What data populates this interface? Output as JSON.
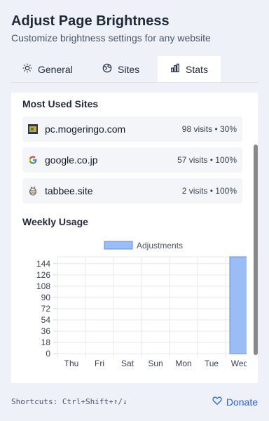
{
  "header": {
    "title": "Adjust Page Brightness",
    "subtitle": "Customize brightness settings for any website"
  },
  "tabs": [
    {
      "label": "General",
      "icon": "sun-icon"
    },
    {
      "label": "Sites",
      "icon": "globe-icon"
    },
    {
      "label": "Stats",
      "icon": "bar-chart-icon",
      "active": true
    }
  ],
  "most_used": {
    "title": "Most Used Sites",
    "sites": [
      {
        "name": "pc.mogeringo.com",
        "stats": "98 visits • 30%",
        "icon": "site-favicon"
      },
      {
        "name": "google.co.jp",
        "stats": "57 visits • 100%",
        "icon": "google-favicon"
      },
      {
        "name": "tabbee.site",
        "stats": "2 visits • 100%",
        "icon": "tabbee-favicon"
      }
    ]
  },
  "weekly": {
    "title": "Weekly Usage"
  },
  "chart_data": {
    "type": "bar",
    "categories": [
      "Thu",
      "Fri",
      "Sat",
      "Sun",
      "Mon",
      "Tue",
      "Wed"
    ],
    "series": [
      {
        "name": "Adjustments",
        "values": [
          0,
          0,
          0,
          0,
          0,
          0,
          155
        ]
      }
    ],
    "y_ticks": [
      0,
      18,
      36,
      54,
      72,
      90,
      108,
      126,
      144
    ],
    "ylim": [
      0,
      155
    ],
    "legend_position": "top",
    "grid": true,
    "bar_color": "#9bbdf5",
    "bar_border": "#5b8def"
  },
  "footer": {
    "shortcuts": "Shortcuts: Ctrl+Shift+↑/↓",
    "donate": "Donate"
  },
  "colors": {
    "accent": "#2563eb",
    "background": "#eef1f8"
  }
}
